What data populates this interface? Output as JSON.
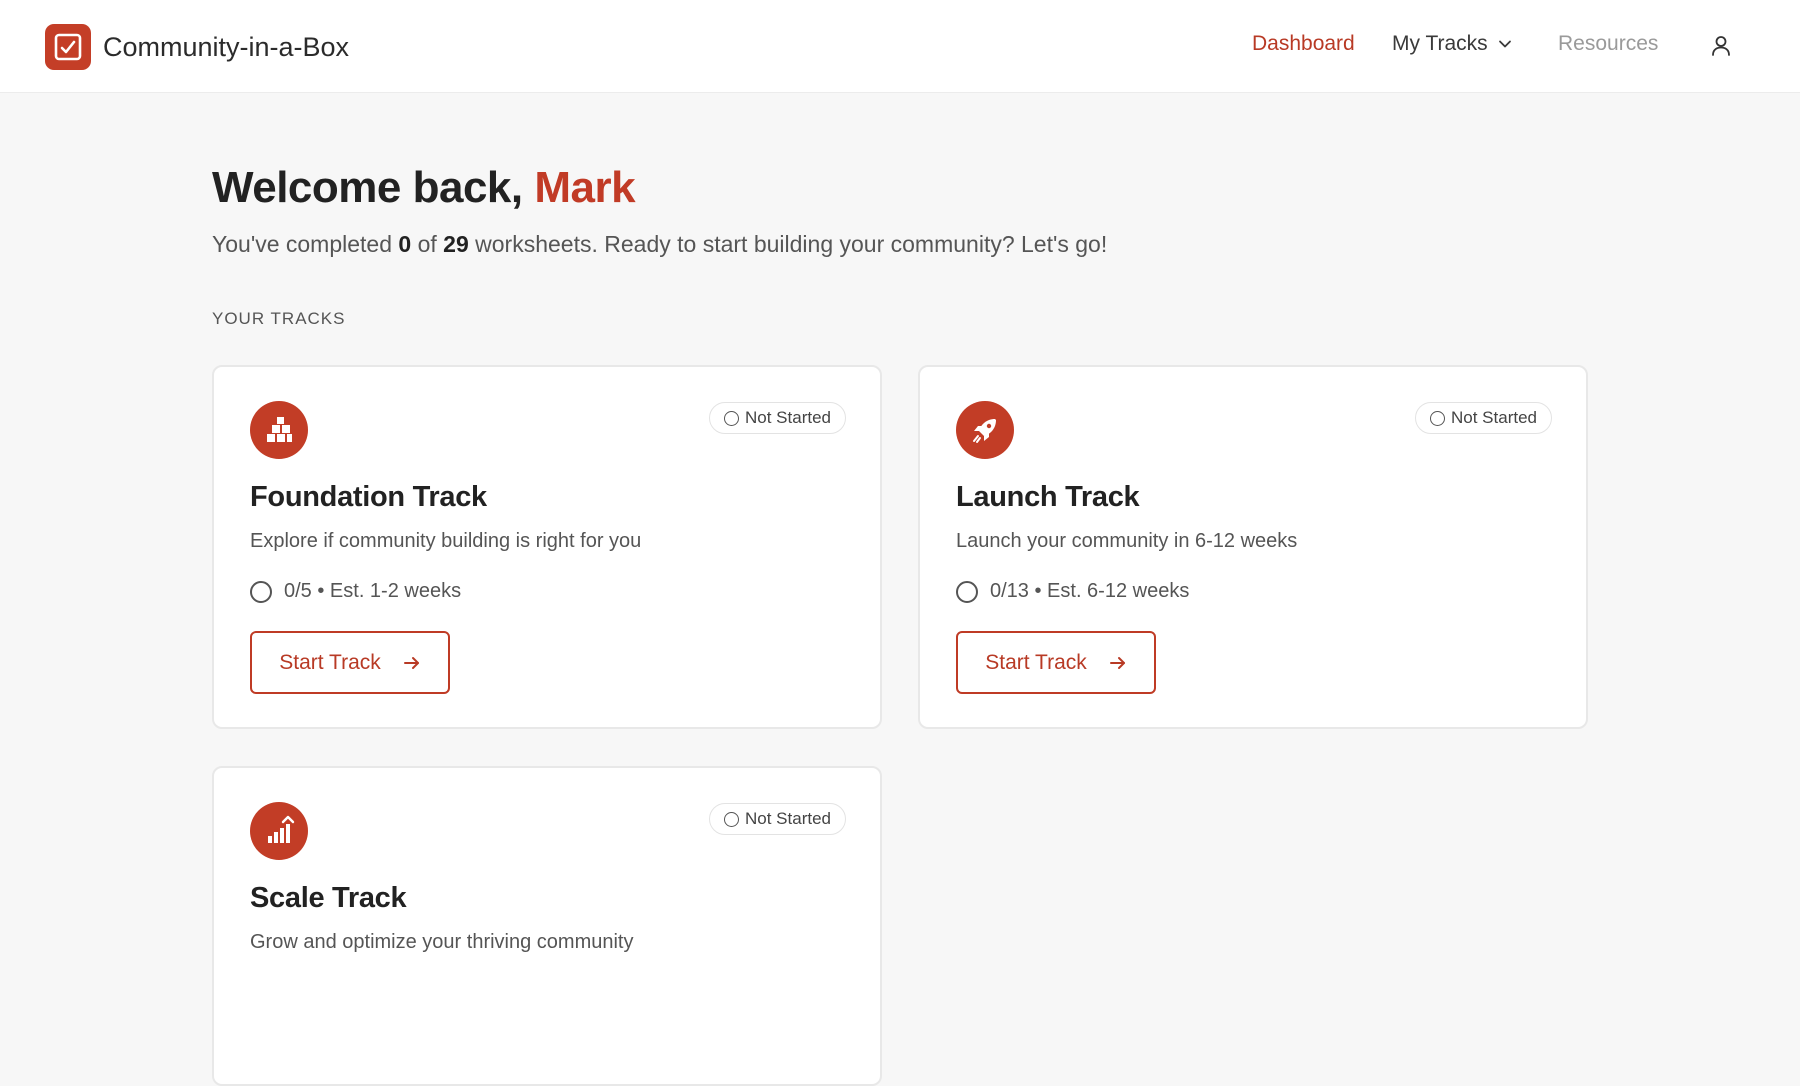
{
  "brand": {
    "name": "Community-in-a-Box",
    "accent": "#c43e27"
  },
  "nav": {
    "dashboard": "Dashboard",
    "my_tracks": "My Tracks",
    "resources": "Resources"
  },
  "welcome": {
    "greeting": "Welcome back, ",
    "name": "Mark",
    "sub_prefix": "You've completed ",
    "completed": "0",
    "sub_of": " of ",
    "total": "29",
    "sub_suffix": " worksheets. Ready to start building your community? Let's go!"
  },
  "section_title": "YOUR TRACKS",
  "tracks": [
    {
      "icon": "blocks-icon",
      "status": "Not Started",
      "title": "Foundation Track",
      "description": "Explore if community building is right for you",
      "progress": "0/5 • Est. 1-2 weeks",
      "button": "Start Track"
    },
    {
      "icon": "rocket-icon",
      "status": "Not Started",
      "title": "Launch Track",
      "description": "Launch your community in 6-12 weeks",
      "progress": "0/13 • Est. 6-12 weeks",
      "button": "Start Track"
    },
    {
      "icon": "growth-chart-icon",
      "status": "Not Started",
      "title": "Scale Track",
      "description": "Grow and optimize your thriving community"
    }
  ]
}
